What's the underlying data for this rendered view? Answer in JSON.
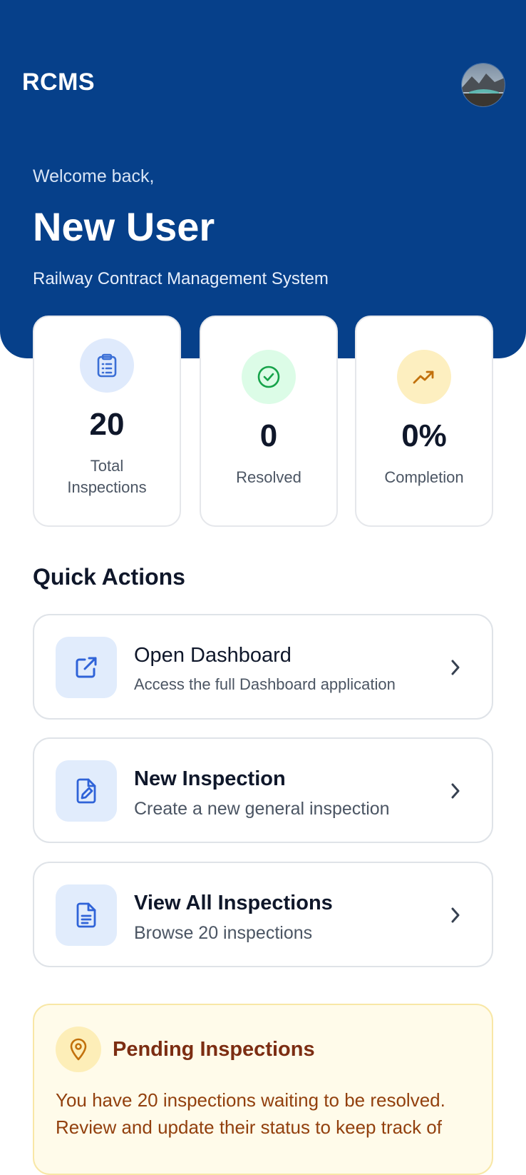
{
  "header": {
    "app_title": "RCMS"
  },
  "hero": {
    "welcome": "Welcome back,",
    "user_name": "New User",
    "subtitle": "Railway Contract Management System"
  },
  "stats": [
    {
      "value": "20",
      "label": "Total Inspections",
      "icon": "clipboard-list-icon",
      "color": "#3b6fd6",
      "bg": "#dfeafc"
    },
    {
      "value": "0",
      "label": "Resolved",
      "icon": "check-circle-icon",
      "color": "#16a34a",
      "bg": "#dcfce7"
    },
    {
      "value": "0%",
      "label": "Completion",
      "icon": "trending-up-icon",
      "color": "#c2710c",
      "bg": "#fdefc0"
    }
  ],
  "quick_actions": {
    "title": "Quick Actions",
    "items": [
      {
        "title": "Open Dashboard",
        "description": "Access the full Dashboard application",
        "icon": "external-link-icon"
      },
      {
        "title": "New Inspection",
        "description": "Create a new general inspection",
        "icon": "file-edit-icon"
      },
      {
        "title": "View All Inspections",
        "description": "Browse 20 inspections",
        "icon": "file-text-icon"
      }
    ]
  },
  "pending": {
    "title": "Pending Inspections",
    "text": "You have 20 inspections waiting to be resolved. Review and update their status to keep track of",
    "icon": "map-pin-icon"
  },
  "colors": {
    "primary": "#06408a",
    "accent_blue": "#2f63d8",
    "pending_bg": "#fffbea",
    "pending_title": "#7c2d12"
  }
}
